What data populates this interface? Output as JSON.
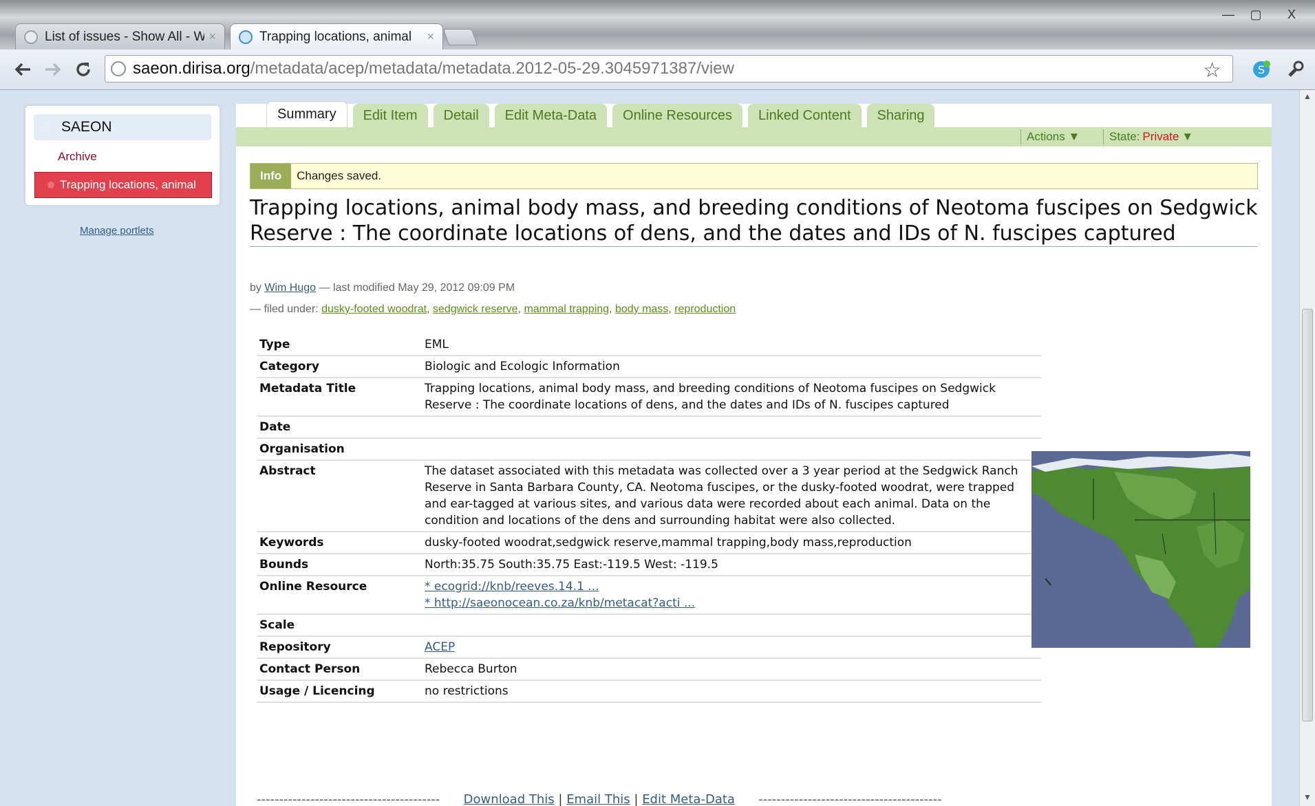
{
  "browser": {
    "tabs": [
      {
        "title": "List of issues - Show All - W",
        "active": false
      },
      {
        "title": "Trapping locations, animal",
        "active": true
      }
    ],
    "url_host": "saeon.dirisa.org",
    "url_path": "/metadata/acep/metadata/metadata.2012-05-29.3045971387/view",
    "window_controls": {
      "minimize": "—",
      "maximize": "▢",
      "close": "X"
    },
    "tab_close": "×"
  },
  "sidebar": {
    "portlet_title": "SAEON",
    "archive_link": "Archive",
    "current_item": "Trapping locations, animal",
    "manage_link": "Manage portlets"
  },
  "content_tabs": [
    "Summary",
    "Edit Item",
    "Detail",
    "Edit Meta-Data",
    "Online Resources",
    "Linked Content",
    "Sharing"
  ],
  "actions": {
    "actions_label": "Actions ▼",
    "state_label": "State:",
    "state_value": "Private",
    "state_arrow": "▼"
  },
  "info": {
    "label": "Info",
    "message": "Changes saved."
  },
  "document": {
    "title": "Trapping locations, animal body mass, and breeding conditions of Neotoma fuscipes on Sedgwick Reserve : The coordinate locations of dens, and the dates and IDs of N. fuscipes captured",
    "by_prefix": "by",
    "author": "Wim Hugo",
    "modified": "— last modified May 29, 2012 09:09 PM",
    "filed_prefix": "— filed under:",
    "tags": [
      "dusky-footed woodrat",
      "sedgwick reserve",
      "mammal trapping",
      "body mass",
      "reproduction"
    ]
  },
  "metadata": {
    "type_label": "Type",
    "type_value": "EML",
    "category_label": "Category",
    "category_value": "Biologic and Ecologic Information",
    "metadata_title_label": "Metadata Title",
    "metadata_title_value": "Trapping locations, animal body mass, and breeding conditions of Neotoma fuscipes on Sedgwick Reserve : The coordinate locations of dens, and the dates and IDs of N. fuscipes captured",
    "date_label": "Date",
    "date_value": "",
    "organisation_label": "Organisation",
    "organisation_value": "",
    "abstract_label": "Abstract",
    "abstract_value": "The dataset associated with this metadata was collected over a 3 year period at the Sedgwick Ranch Reserve in Santa Barbara County, CA. Neotoma fuscipes, or the dusky-footed woodrat, were trapped and ear-tagged at various sites, and various data were recorded about each animal. Data on the condition and locations of the dens and surrounding habitat were also collected.",
    "keywords_label": "Keywords",
    "keywords_value": "dusky-footed woodrat,sedgwick reserve,mammal trapping,body mass,reproduction",
    "bounds_label": "Bounds",
    "bounds_value": "North:35.75 South:35.75 East:-119.5 West: -119.5",
    "online_resource_label": "Online Resource",
    "online_resource_1": "* ecogrid://knb/reeves.14.1 ...",
    "online_resource_2": "* http://saeonocean.co.za/knb/metacat?acti ...",
    "scale_label": "Scale",
    "scale_value": "",
    "repository_label": "Repository",
    "repository_value": "ACEP",
    "contact_label": "Contact Person",
    "contact_value": "Rebecca Burton",
    "usage_label": "Usage / Licencing",
    "usage_value": "no restrictions"
  },
  "footer": {
    "dashes": "-----------------------------------------",
    "download": "Download This",
    "email": "Email This",
    "edit": "Edit Meta-Data",
    "sep": "|"
  }
}
